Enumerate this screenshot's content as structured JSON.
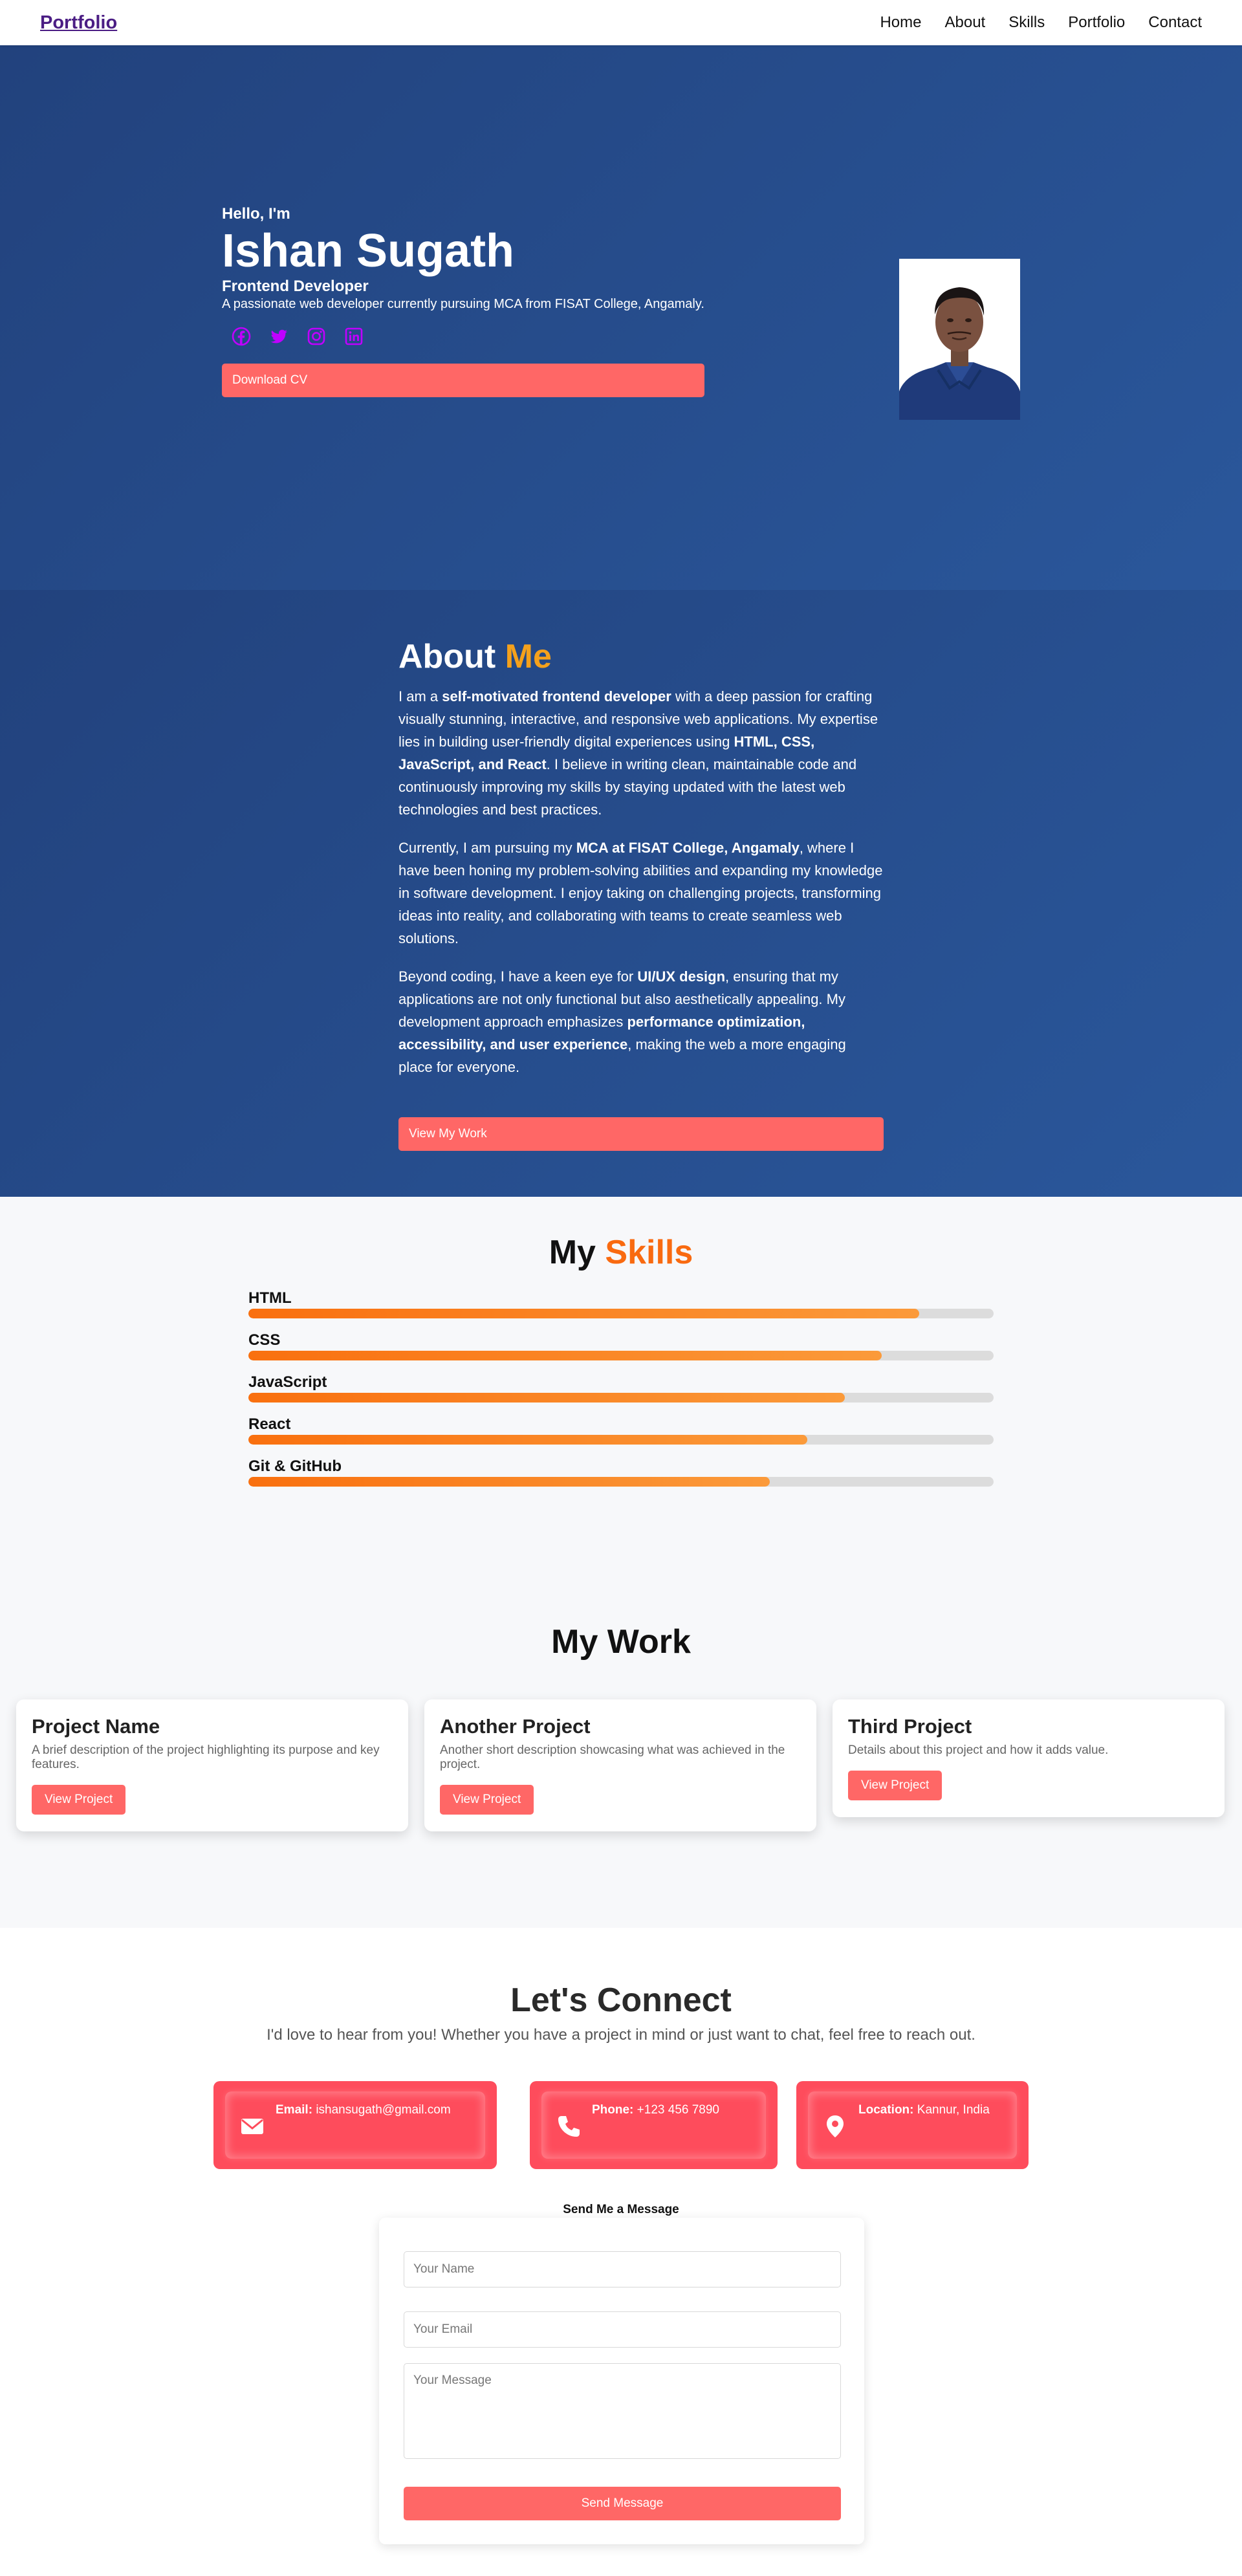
{
  "nav": {
    "brand": "Portfolio",
    "links": [
      "Home",
      "About",
      "Skills",
      "Portfolio",
      "Contact"
    ]
  },
  "hero": {
    "greeting": "Hello, I'm",
    "name": "Ishan Sugath",
    "role": "Frontend Developer",
    "description": "A passionate web developer currently pursuing MCA from FISAT College, Angamaly.",
    "socials": [
      "facebook-icon",
      "twitter-icon",
      "instagram-icon",
      "linkedin-icon"
    ],
    "social_color": "#c000ff",
    "cv_button": "Download CV"
  },
  "about": {
    "title_main": "About",
    "title_accent": "Me",
    "p1": {
      "a": "I am a ",
      "b": "self-motivated frontend developer",
      "c": " with a deep passion for crafting visually stunning, interactive, and responsive web applications. My expertise lies in building user-friendly digital experiences using ",
      "d": "HTML, CSS, JavaScript, and React",
      "e": ". I believe in writing clean, maintainable code and continuously improving my skills by staying updated with the latest web technologies and best practices."
    },
    "p2": {
      "a": "Currently, I am pursuing my ",
      "b": "MCA at FISAT College, Angamaly",
      "c": ", where I have been honing my problem-solving abilities and expanding my knowledge in software development. I enjoy taking on challenging projects, transforming ideas into reality, and collaborating with teams to create seamless web solutions."
    },
    "p3": {
      "a": "Beyond coding, I have a keen eye for ",
      "b": "UI/UX design",
      "c": ", ensuring that my applications are not only functional but also aesthetically appealing. My development approach emphasizes ",
      "d": "performance optimization, accessibility, and user experience",
      "e": ", making the web a more engaging place for everyone."
    },
    "button": "View My Work"
  },
  "skills": {
    "title_main": "My",
    "title_accent": "Skills",
    "items": [
      {
        "name": "HTML",
        "level": 0.9
      },
      {
        "name": "CSS",
        "level": 0.85
      },
      {
        "name": "JavaScript",
        "level": 0.8
      },
      {
        "name": "React",
        "level": 0.75
      },
      {
        "name": "Git & GitHub",
        "level": 0.7
      }
    ]
  },
  "work": {
    "title": "My Work",
    "projects": [
      {
        "title": "Project Name",
        "desc": "A brief description of the project highlighting its purpose and key features.",
        "button": "View Project"
      },
      {
        "title": "Another Project",
        "desc": "Another short description showcasing what was achieved in the project.",
        "button": "View Project"
      },
      {
        "title": "Third Project",
        "desc": "Details about this project and how it adds value.",
        "button": "View Project"
      }
    ]
  },
  "connect": {
    "title": "Let's Connect",
    "subtitle": "I'd love to hear from you! Whether you have a project in mind or just want to chat, feel free to reach out.",
    "cards": [
      {
        "label": "Email:",
        "value": "ishansugath@gmail.com",
        "icon": "envelope-icon"
      },
      {
        "label": "Phone:",
        "value": "+123 456 7890",
        "icon": "phone-icon"
      },
      {
        "label": "Location:",
        "value": "Kannur, India",
        "icon": "location-pin-icon"
      }
    ],
    "form_label": "Send Me a Message",
    "form": {
      "name_placeholder": "Your Name",
      "email_placeholder": "Your Email",
      "message_placeholder": "Your Message",
      "submit": "Send Message"
    }
  }
}
